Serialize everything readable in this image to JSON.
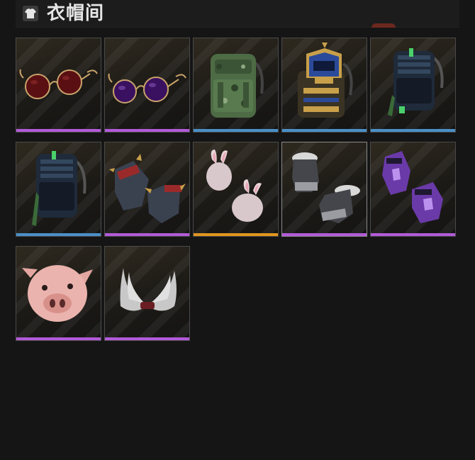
{
  "header": {
    "title": "衣帽间",
    "icon": "shirt-icon"
  },
  "colors": {
    "purple": "#b35ad8",
    "blue": "#4a90c8",
    "orange": "#e0961e"
  },
  "items": [
    {
      "name": "red-round-sunglasses",
      "icon": "sunglasses-icon",
      "rarity": "purple"
    },
    {
      "name": "purple-round-sunglasses",
      "icon": "sunglasses-icon",
      "rarity": "purple"
    },
    {
      "name": "camo-backpack",
      "icon": "backpack-icon",
      "rarity": "blue"
    },
    {
      "name": "pharaoh-backpack",
      "icon": "backpack-icon",
      "rarity": "blue"
    },
    {
      "name": "navy-tactical-backpack",
      "icon": "backpack-icon",
      "rarity": "blue"
    },
    {
      "name": "navy-tactical-backpack-2",
      "icon": "backpack-icon",
      "rarity": "blue"
    },
    {
      "name": "spiked-gauntlets",
      "icon": "gloves-icon",
      "rarity": "purple"
    },
    {
      "name": "bunny-mittens",
      "icon": "gloves-icon",
      "rarity": "orange"
    },
    {
      "name": "fur-trim-gloves",
      "icon": "gloves-icon",
      "rarity": "purple"
    },
    {
      "name": "purple-rune-gloves",
      "icon": "gloves-icon",
      "rarity": "purple"
    },
    {
      "name": "pig-mask",
      "icon": "pig-mask-icon",
      "rarity": "purple"
    },
    {
      "name": "feather-wings",
      "icon": "wings-icon",
      "rarity": "purple"
    }
  ]
}
